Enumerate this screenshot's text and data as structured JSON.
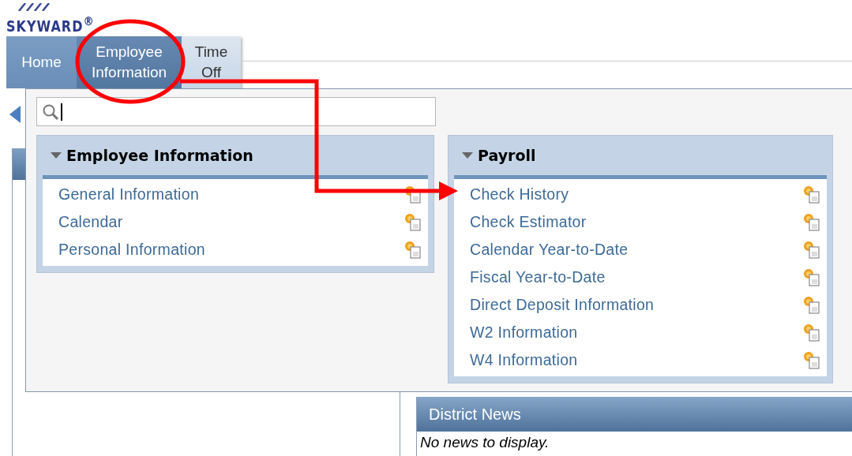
{
  "logo": {
    "text": "SKYWARD$^{®}$"
  },
  "nav_tabs": [
    {
      "label": "Home",
      "selected": false,
      "kind": "dark"
    },
    {
      "label": "Employee Information",
      "selected": true,
      "kind": "dark"
    },
    {
      "label": "Time Off",
      "selected": false,
      "kind": "light"
    }
  ],
  "district_news": {
    "title": "District News",
    "message": "No news to display."
  },
  "dropdown": {
    "groups": [
      {
        "title": "Employee Information",
        "expanded": true,
        "items": [
          "General Information",
          "Calendar",
          "Personal Information"
        ]
      },
      {
        "title": "Payroll",
        "expanded": true,
        "items": [
          "Check History",
          "Check Estimator",
          "Calendar Year-to-Date",
          "Fiscal Year-to-Date",
          "Direct Deposit Information",
          "W2 Information",
          "W4 Information"
        ]
      }
    ]
  }
}
